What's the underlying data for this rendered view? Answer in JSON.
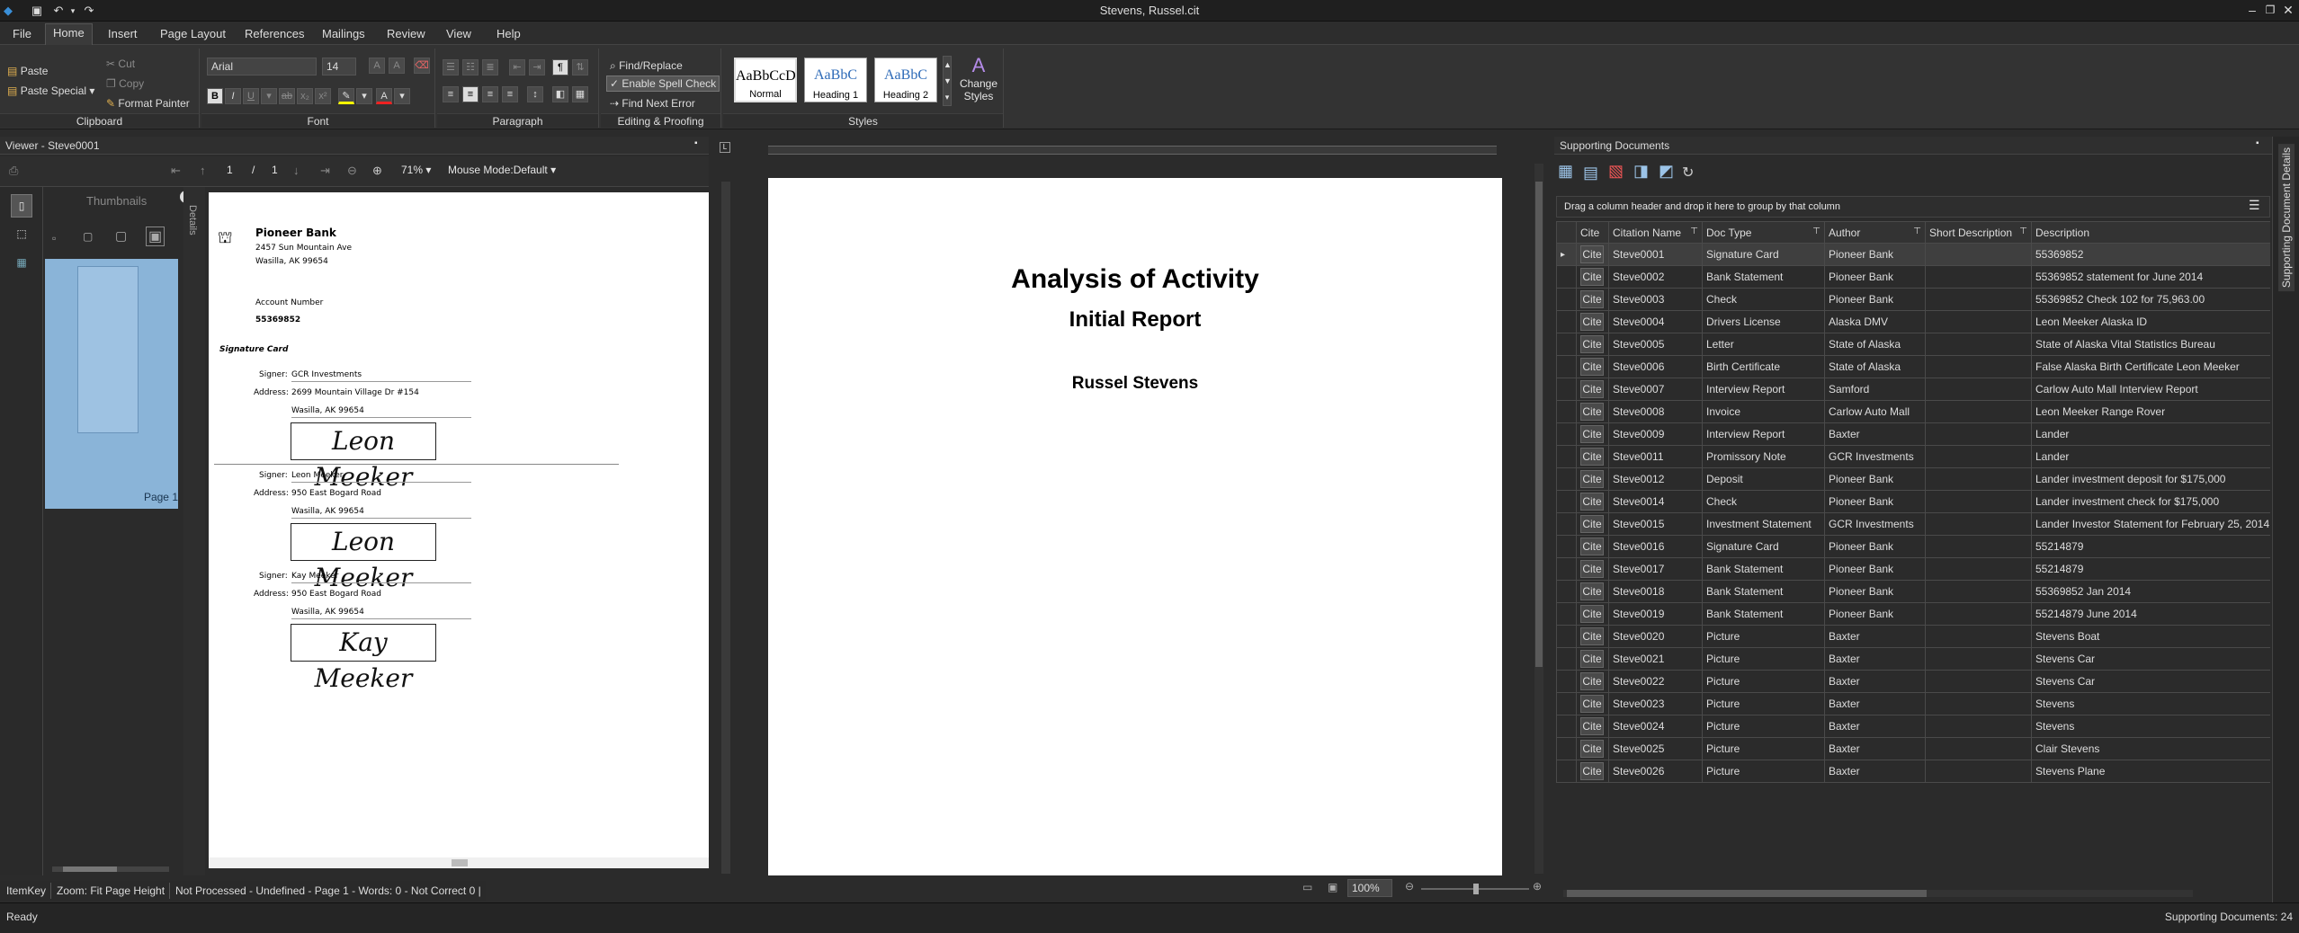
{
  "window": {
    "title": "Stevens, Russel.cit"
  },
  "menu": [
    "File",
    "Home",
    "Insert",
    "Page Layout",
    "References",
    "Mailings",
    "Review",
    "View",
    "Help"
  ],
  "ribbon": {
    "clipboard": {
      "label": "Clipboard",
      "paste": "Paste",
      "paste_special": "Paste Special",
      "cut": "Cut",
      "copy": "Copy",
      "format_painter": "Format Painter"
    },
    "font": {
      "label": "Font",
      "name": "Arial",
      "size": "14"
    },
    "paragraph": {
      "label": "Paragraph"
    },
    "editing": {
      "label": "Editing & Proofing",
      "find_replace": "Find/Replace",
      "spell": "Enable Spell Check",
      "find_next": "Find Next Error"
    },
    "styles": {
      "label": "Styles",
      "items": [
        {
          "preview": "AaBbCcDd",
          "name": "Normal"
        },
        {
          "preview": "AaBbC",
          "name": "Heading 1"
        },
        {
          "preview": "AaBbC",
          "name": "Heading 2"
        }
      ],
      "change": "Change Styles"
    }
  },
  "viewer": {
    "title": "Viewer - Steve0001",
    "page": "1",
    "total": "1",
    "zoom": "71%",
    "mode": "Mouse Mode:Default",
    "thumbnails": "Thumbnails",
    "page_label": "Page 1",
    "details": "Details"
  },
  "doc": {
    "bank": "Pioneer Bank",
    "addr1": "2457 Sun Mountain Ave",
    "addr2": "Wasilla, AK 99654",
    "acct_label": "Account Number",
    "acct": "55369852",
    "section": "Signature Card",
    "signers": [
      {
        "signer_label": "Signer:",
        "signer": "GCR Investments",
        "address_label": "Address:",
        "address": "2699 Mountain Village Dr #154",
        "city": "Wasilla, AK 99654",
        "sig": "Leon Meeker"
      },
      {
        "signer_label": "Signer:",
        "signer": "Leon Meeker",
        "address_label": "Address:",
        "address": "950 East Bogard Road",
        "city": "Wasilla, AK 99654",
        "sig": "Leon Meeker"
      },
      {
        "signer_label": "Signer:",
        "signer": "Kay Meeker",
        "address_label": "Address:",
        "address": "950 East Bogard Road",
        "city": "Wasilla, AK 99654",
        "sig": "Kay Meeker"
      }
    ]
  },
  "editor": {
    "title": "Analysis of Activity",
    "subtitle": "Initial Report",
    "author": "Russel Stevens",
    "zoom": "100%"
  },
  "support": {
    "title": "Supporting Documents",
    "group_hint": "Drag a column header and drop it here to group by that column",
    "side_tab": "Supporting Document Details",
    "columns": [
      "Cite",
      "Citation Name",
      "Doc Type",
      "Author",
      "Short Description",
      "Description"
    ],
    "rows": [
      [
        "Cite",
        "Steve0001",
        "Signature Card",
        "Pioneer Bank",
        "",
        "55369852"
      ],
      [
        "Cite",
        "Steve0002",
        "Bank Statement",
        "Pioneer Bank",
        "",
        "55369852 statement for June 2014"
      ],
      [
        "Cite",
        "Steve0003",
        "Check",
        "Pioneer Bank",
        "",
        "55369852 Check 102 for 75,963.00"
      ],
      [
        "Cite",
        "Steve0004",
        "Drivers License",
        "Alaska DMV",
        "",
        "Leon Meeker Alaska ID"
      ],
      [
        "Cite",
        "Steve0005",
        "Letter",
        "State of Alaska",
        "",
        "State of Alaska Vital Statistics Bureau"
      ],
      [
        "Cite",
        "Steve0006",
        "Birth Certificate",
        "State of Alaska",
        "",
        "False Alaska Birth Certificate Leon Meeker"
      ],
      [
        "Cite",
        "Steve0007",
        "Interview Report",
        "Samford",
        "",
        "Carlow Auto Mall Interview Report"
      ],
      [
        "Cite",
        "Steve0008",
        "Invoice",
        "Carlow Auto Mall",
        "",
        "Leon Meeker Range Rover"
      ],
      [
        "Cite",
        "Steve0009",
        "Interview Report",
        "Baxter",
        "",
        "Lander"
      ],
      [
        "Cite",
        "Steve0011",
        "Promissory Note",
        "GCR Investments",
        "",
        "Lander"
      ],
      [
        "Cite",
        "Steve0012",
        "Deposit",
        "Pioneer Bank",
        "",
        "Lander investment deposit for $175,000"
      ],
      [
        "Cite",
        "Steve0014",
        "Check",
        "Pioneer Bank",
        "",
        "Lander investment check for $175,000"
      ],
      [
        "Cite",
        "Steve0015",
        "Investment Statement",
        "GCR Investments",
        "",
        "Lander Investor Statement for February 25, 2014"
      ],
      [
        "Cite",
        "Steve0016",
        "Signature Card",
        "Pioneer Bank",
        "",
        "55214879"
      ],
      [
        "Cite",
        "Steve0017",
        "Bank Statement",
        "Pioneer Bank",
        "",
        "55214879"
      ],
      [
        "Cite",
        "Steve0018",
        "Bank Statement",
        "Pioneer Bank",
        "",
        "55369852 Jan 2014"
      ],
      [
        "Cite",
        "Steve0019",
        "Bank Statement",
        "Pioneer Bank",
        "",
        "55214879 June 2014"
      ],
      [
        "Cite",
        "Steve0020",
        "Picture",
        "Baxter",
        "",
        "Stevens Boat"
      ],
      [
        "Cite",
        "Steve0021",
        "Picture",
        "Baxter",
        "",
        "Stevens Car"
      ],
      [
        "Cite",
        "Steve0022",
        "Picture",
        "Baxter",
        "",
        "Stevens Car"
      ],
      [
        "Cite",
        "Steve0023",
        "Picture",
        "Baxter",
        "",
        "Stevens"
      ],
      [
        "Cite",
        "Steve0024",
        "Picture",
        "Baxter",
        "",
        "Stevens"
      ],
      [
        "Cite",
        "Steve0025",
        "Picture",
        "Baxter",
        "",
        "Clair Stevens"
      ],
      [
        "Cite",
        "Steve0026",
        "Picture",
        "Baxter",
        "",
        "Stevens Plane"
      ]
    ]
  },
  "status": {
    "ready": "Ready",
    "itemkey": "ItemKey",
    "zoomfit": "Zoom: Fit Page Height",
    "info": "Not Processed - Undefined - Page 1 - Words: 0 - Not Correct 0 |",
    "count": "Supporting Documents: 24"
  }
}
